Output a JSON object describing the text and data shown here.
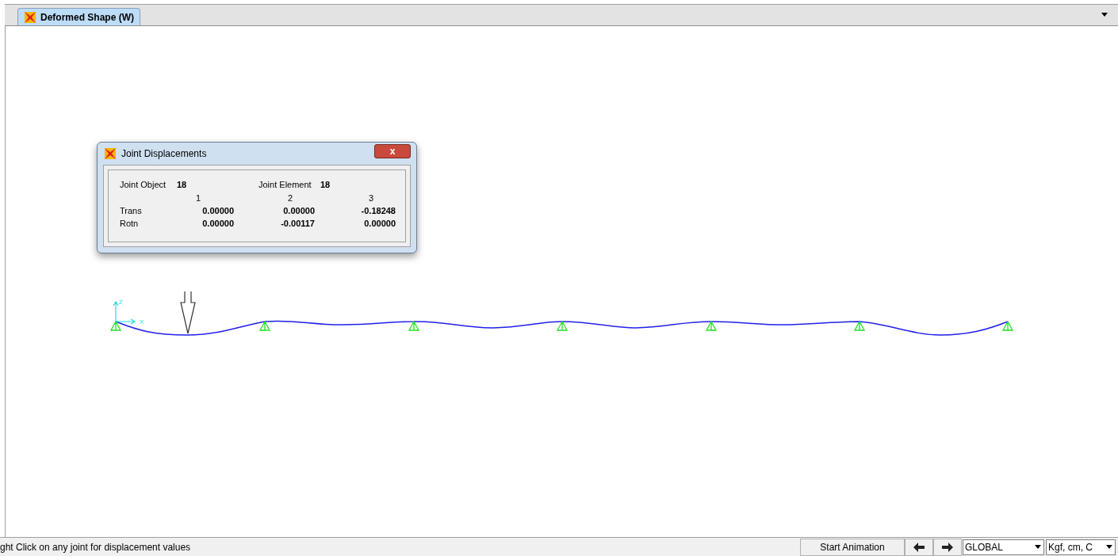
{
  "tabs": [
    {
      "label": "Deformed Shape (W)",
      "selected": true
    }
  ],
  "canvas": {
    "axis_labels": [
      "Z",
      "X"
    ]
  },
  "dialog": {
    "title": "Joint Displacements",
    "close": "x",
    "object_label": "Joint  Object",
    "object_value": "18",
    "element_label": "Joint Element",
    "element_value": "18",
    "columns": [
      "1",
      "2",
      "3"
    ],
    "rows": [
      {
        "label": "Trans",
        "values": [
          "0.00000",
          "0.00000",
          "-0.18248"
        ]
      },
      {
        "label": "Rotn",
        "values": [
          "0.00000",
          "-0.00117",
          "0.00000"
        ]
      }
    ]
  },
  "status_bar": {
    "message": "ght Click on any joint for displacement values",
    "animation_button": "Start Animation",
    "coord_system": "GLOBAL",
    "units": "Kgf, cm, C"
  }
}
